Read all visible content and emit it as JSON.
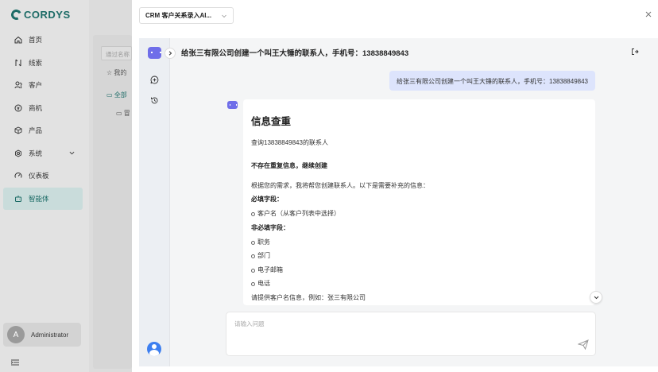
{
  "app": {
    "brand": "CORDYS"
  },
  "sidebar": {
    "items": [
      {
        "label": "首页",
        "icon": "home-icon"
      },
      {
        "label": "线索",
        "icon": "lead-icon"
      },
      {
        "label": "客户",
        "icon": "customer-icon"
      },
      {
        "label": "商机",
        "icon": "opportunity-icon"
      },
      {
        "label": "产品",
        "icon": "product-icon"
      },
      {
        "label": "系统",
        "icon": "settings-icon"
      },
      {
        "label": "仪表板",
        "icon": "dashboard-icon"
      },
      {
        "label": "智能体",
        "icon": "agent-icon",
        "active": true
      }
    ],
    "user": {
      "initial": "A",
      "name": "Administrator"
    }
  },
  "background": {
    "search_placeholder": "通过名称",
    "favorites": "我的",
    "all": "全部",
    "sub": "冒"
  },
  "drawer": {
    "agent_selector": "CRM 客户关系录入AI...",
    "chat_title": "给张三有限公司创建一个叫王大锤的联系人，手机号：13838849843",
    "user_message": "给张三有限公司创建一个叫王大锤的联系人，手机号：13838849843",
    "answer": {
      "heading": "信息查重",
      "query": "查询13838849843的联系人",
      "no_dup": "不存在重复信息，继续创建",
      "intro": "根据您的需求，我将帮您创建联系人。以下是需要补充的信息：",
      "required_label": "必填字段：",
      "required": [
        "客户名（从客户列表中选择）"
      ],
      "optional_label": "非必填字段：",
      "optional": [
        "职务",
        "部门",
        "电子邮箱",
        "电话"
      ],
      "more": "请提供客户名信息，例如：张三有限公司"
    },
    "input_placeholder": "请输入问题"
  },
  "colors": {
    "brand": "#1c6b66",
    "agent": "#6f6ee9",
    "user_bubble": "#dde4fc"
  }
}
